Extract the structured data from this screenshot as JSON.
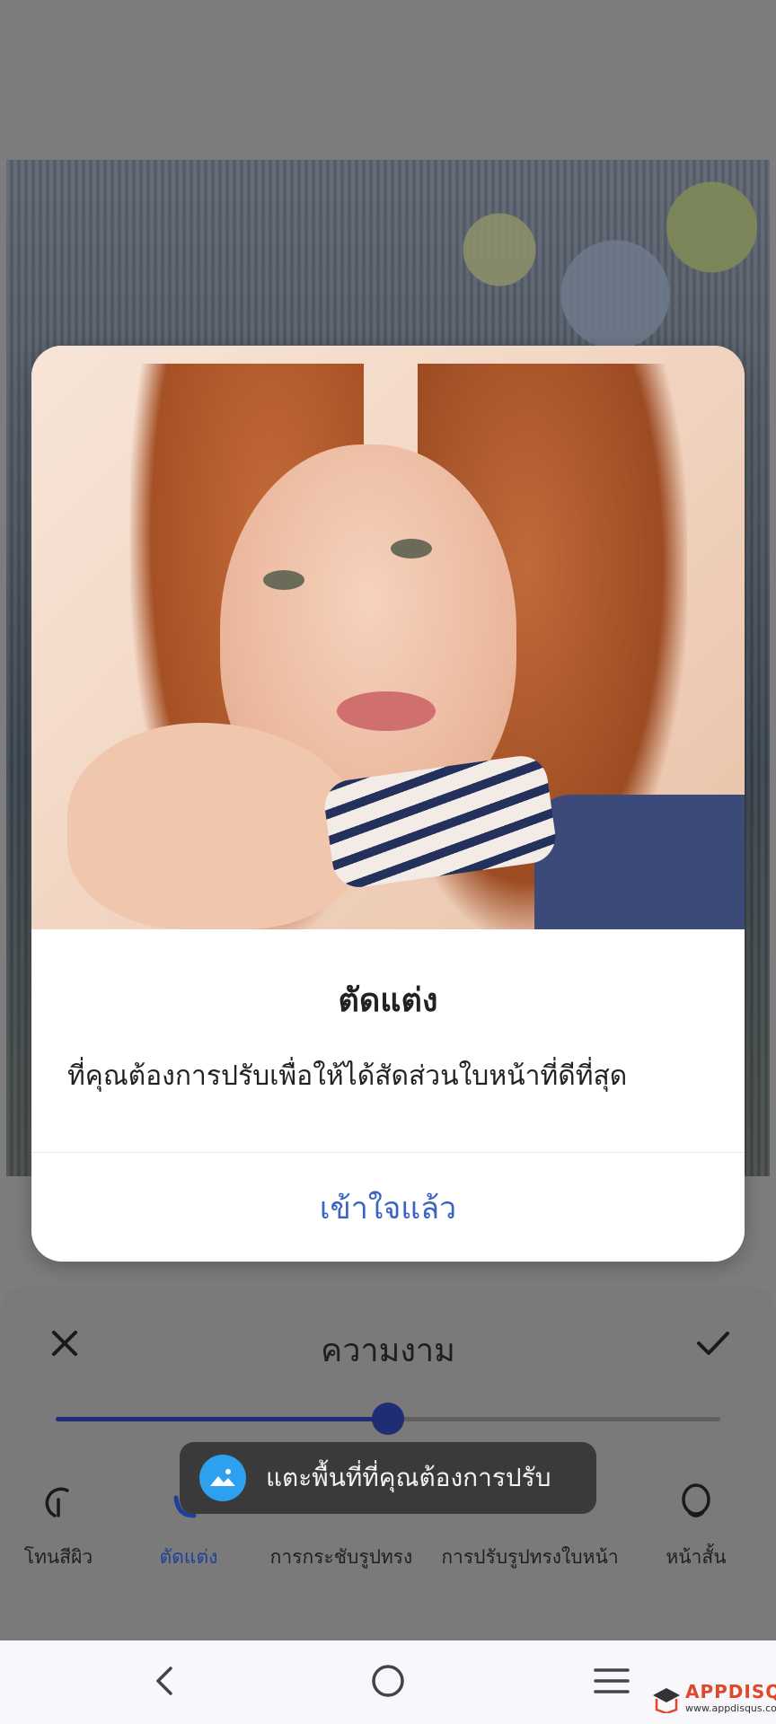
{
  "dialog": {
    "title": "ตัดแต่ง",
    "message": "ที่คุณต้องการปรับเพื่อให้ได้สัดส่วนใบหน้าที่ดีที่สุด",
    "ok_label": "เข้าใจแล้ว"
  },
  "panel": {
    "title": "ความงาม",
    "slider_value": 0.5
  },
  "tools": [
    {
      "label": "โทนสีผิว"
    },
    {
      "label": "ตัดแต่ง"
    },
    {
      "label": "การกระชับรูปทรง"
    },
    {
      "label": "การปรับรูปทรงใบหน้า"
    },
    {
      "label": "หน้าสั้น"
    }
  ],
  "toast": {
    "text": "แตะพื้นที่ที่คุณต้องการปรับ"
  },
  "watermark": {
    "title": "APPDISQUS",
    "url": "www.appdisqus.com"
  },
  "colors": {
    "accent": "#1e2d74",
    "link": "#3b63c4",
    "toast_icon": "#2ea0f0"
  }
}
